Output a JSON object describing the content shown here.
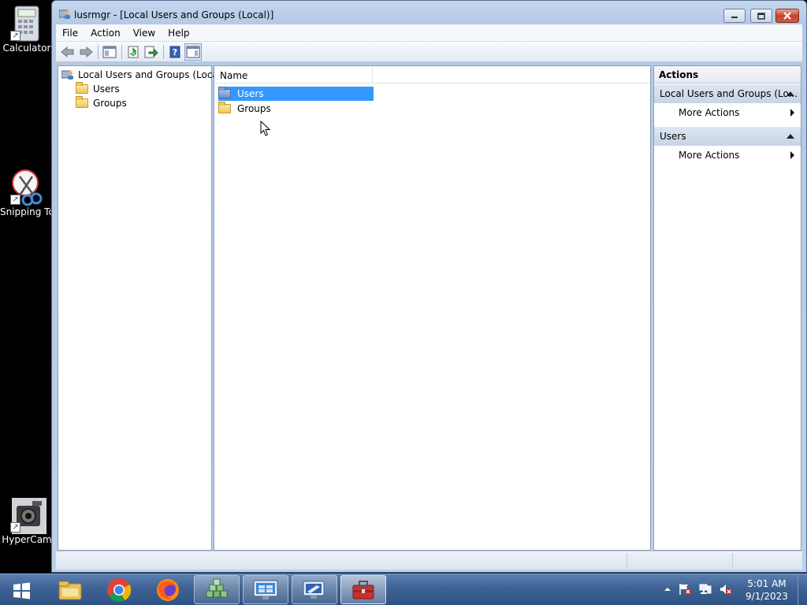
{
  "desktop": {
    "icons": [
      {
        "label": "Calculator",
        "icon": "calculator-icon"
      },
      {
        "label": "Snipping Tc",
        "icon": "scissors-icon"
      },
      {
        "label": "HyperCam",
        "icon": "camera-icon"
      }
    ]
  },
  "window": {
    "title": "lusrmgr - [Local Users and Groups (Local)]",
    "menu": [
      "File",
      "Action",
      "View",
      "Help"
    ],
    "toolbar_icons": [
      "back-arrow-icon",
      "forward-arrow-icon",
      "show-hide-console-tree-icon",
      "refresh-icon",
      "export-list-icon",
      "help-icon",
      "show-hide-action-pane-icon"
    ],
    "tree": {
      "root": "Local Users and Groups (Local)",
      "children": [
        "Users",
        "Groups"
      ]
    },
    "list": {
      "column_header": "Name",
      "rows": [
        {
          "name": "Users",
          "selected": true
        },
        {
          "name": "Groups",
          "selected": false
        }
      ]
    },
    "actions": {
      "header": "Actions",
      "groups": [
        {
          "title": "Local Users and Groups (Lo...",
          "item": "More Actions"
        },
        {
          "title": "Users",
          "item": "More Actions"
        }
      ]
    }
  },
  "taskbar": {
    "apps": [
      "windows-explorer-icon",
      "chrome-icon",
      "firefox-icon",
      "hyper-v-cubes-icon",
      "remote-desktop-icon",
      "computer-management-icon",
      "toolbox-icon"
    ],
    "clock": {
      "time": "5:01 AM",
      "date": "9/1/2023"
    }
  },
  "colors": {
    "selection": "#3399ff",
    "taskbar": "#3e6293",
    "window_frame": "#b3c9e6"
  }
}
